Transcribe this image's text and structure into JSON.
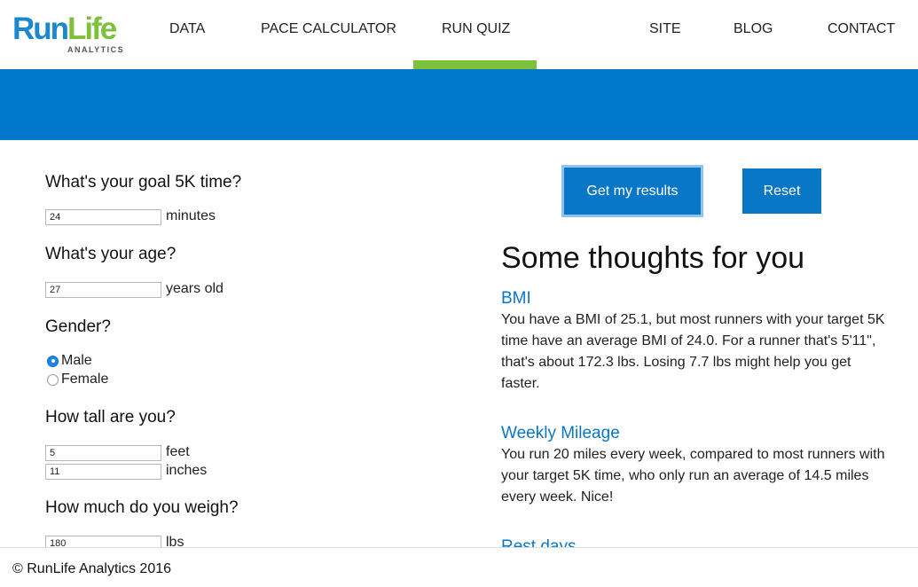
{
  "header": {
    "logo_run": "Run",
    "logo_life": "Life",
    "logo_sub": "ANALYTICS",
    "nav": {
      "data": "DATA",
      "pace_calculator": "PACE CALCULATOR",
      "run_quiz": "RUN QUIZ",
      "site": "SITE",
      "blog": "BLOG",
      "contact": "CONTACT"
    },
    "active_tab": "RUN QUIZ",
    "accent_color": "#7dc13a",
    "band_color": "#0077c8"
  },
  "form": {
    "goal": {
      "question": "What's your goal 5K time?",
      "value": "24",
      "unit": "minutes"
    },
    "age": {
      "question": "What's your age?",
      "value": "27",
      "unit": "years old"
    },
    "gender": {
      "question": "Gender?",
      "options": [
        "Male",
        "Female"
      ],
      "selected": "Male"
    },
    "height": {
      "question": "How tall are you?",
      "feet_value": "5",
      "feet_unit": "feet",
      "inches_value": "11",
      "inches_unit": "inches"
    },
    "weight": {
      "question": "How much do you weigh?",
      "value": "180",
      "unit": "lbs"
    }
  },
  "actions": {
    "results_label": "Get my results",
    "reset_label": "Reset"
  },
  "results": {
    "title": "Some thoughts for you",
    "sections": [
      {
        "heading": "BMI",
        "text": "You have a BMI of 25.1, but most runners with your target 5K time have an average BMI of 24.0. For a runner that's 5'11\", that's about 172.3 lbs. Losing 7.7 lbs might help you get faster."
      },
      {
        "heading": "Weekly Mileage",
        "text": "You run 20 miles every week, compared to most runners with your target 5K time, who only run an average of 14.5 miles every week. Nice!"
      },
      {
        "heading": "Rest days",
        "text": ""
      }
    ]
  },
  "footer": {
    "copyright": "© RunLife Analytics 2016"
  }
}
